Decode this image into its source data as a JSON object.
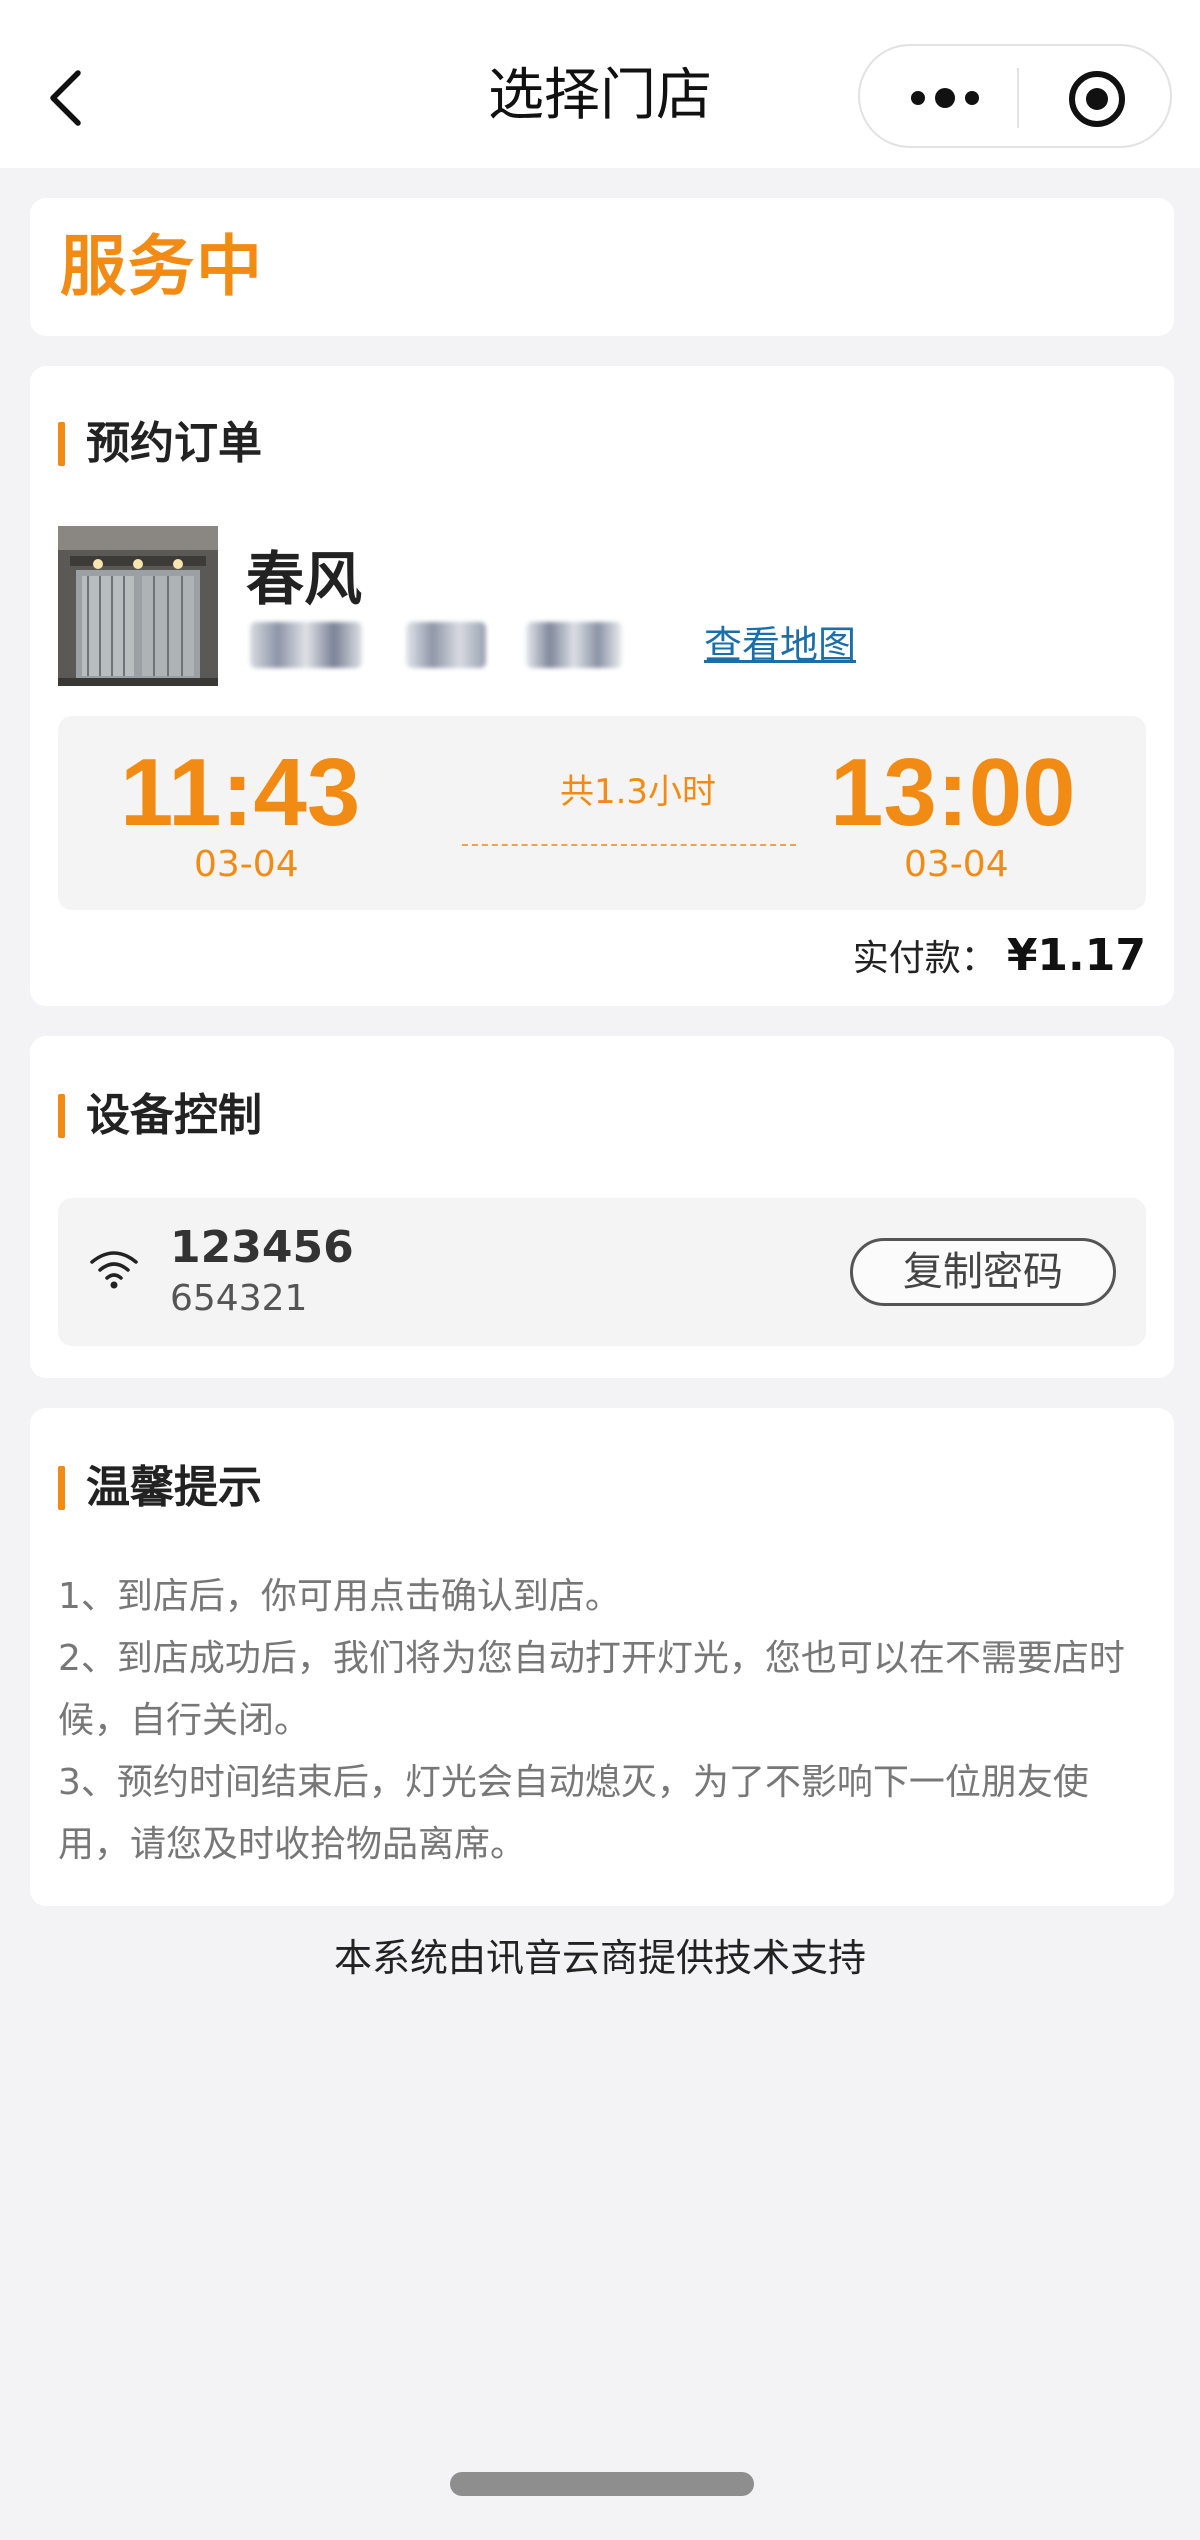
{
  "nav": {
    "title": "选择门店",
    "back_icon": "chevron-left-icon",
    "more_icon": "ellipsis-icon",
    "close_icon": "target-icon"
  },
  "status": {
    "text": "服务中",
    "color": "#f28b14"
  },
  "order": {
    "section_title": "预约订单",
    "store_name": "春风",
    "map_link": "查看地图",
    "start_time": "11:43",
    "start_date": "03-04",
    "end_time": "13:00",
    "end_date": "03-04",
    "duration": "共1.3小时",
    "paid_label": "实付款：",
    "paid_amount": "¥1.17"
  },
  "device": {
    "section_title": "设备控制",
    "wifi_icon": "wifi-icon",
    "ssid": "123456",
    "password": "654321",
    "copy_button": "复制密码"
  },
  "tips": {
    "section_title": "温馨提示",
    "items": [
      "1、到店后，你可用点击确认到店。",
      "2、到店成功后，我们将为您自动打开灯光，您也可以在不需要店时候，自行关闭。",
      "3、预约时间结束后，灯光会自动熄灭，为了不影响下一位朋友使用，请您及时收拾物品离席。"
    ]
  },
  "footer": {
    "text": "本系统由讯音云商提供技术支持"
  },
  "colors": {
    "accent": "#f28b14",
    "link": "#1a6fa8",
    "background": "#f3f3f5"
  }
}
